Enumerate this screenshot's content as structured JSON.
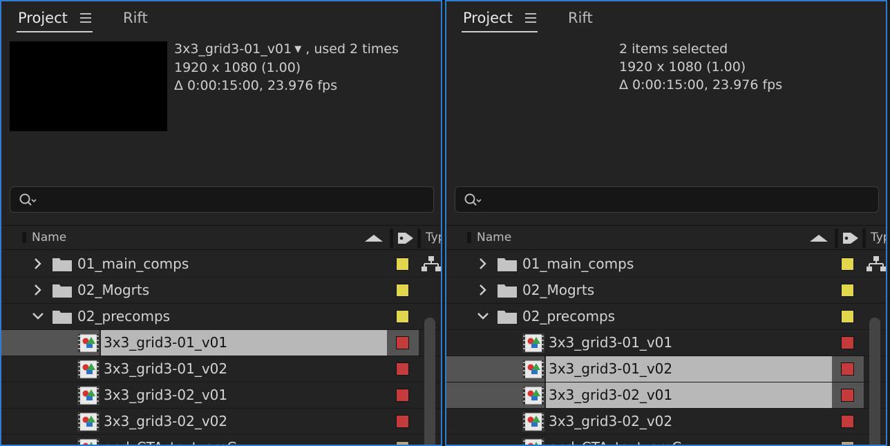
{
  "tabs": {
    "project": "Project",
    "rift": "Rift"
  },
  "search": {
    "placeholder": ""
  },
  "columns": {
    "name": "Name",
    "type": "Typ"
  },
  "colors": {
    "yellow": "#e2d64c",
    "red": "#c33b3b",
    "tan": "#b7a386",
    "accent_border": "#2d7fd6"
  },
  "left_panel": {
    "info": {
      "title": "3x3_grid3-01_v01",
      "used": ", used 2 times",
      "resolution": "1920 x 1080 (1.00)",
      "duration": "Δ 0:00:15:00, 23.976 fps"
    },
    "rows": [
      {
        "name": "01_main_comps",
        "kind": "folder",
        "expanded": false,
        "label": "yellow",
        "selected": false,
        "type_icon": "network-icon"
      },
      {
        "name": "02_Mogrts",
        "kind": "folder",
        "expanded": false,
        "label": "yellow",
        "selected": false
      },
      {
        "name": "02_precomps",
        "kind": "folder",
        "expanded": true,
        "label": "yellow",
        "selected": false
      },
      {
        "name": "3x3_grid3-01_v01",
        "kind": "comp",
        "label": "red",
        "selected": true
      },
      {
        "name": "3x3_grid3-01_v02",
        "kind": "comp",
        "label": "red",
        "selected": false
      },
      {
        "name": "3x3_grid3-02_v01",
        "kind": "comp",
        "label": "red",
        "selected": false
      },
      {
        "name": "3x3_grid3-02_v02",
        "kind": "comp",
        "label": "red",
        "selected": false
      },
      {
        "name": "end_CTA_text_preC",
        "kind": "comp",
        "label": "tan",
        "selected": false
      }
    ]
  },
  "right_panel": {
    "info": {
      "title": "2 items selected",
      "resolution": "1920 x 1080 (1.00)",
      "duration": "Δ 0:00:15:00, 23.976 fps"
    },
    "rows": [
      {
        "name": "01_main_comps",
        "kind": "folder",
        "expanded": false,
        "label": "yellow",
        "selected": false,
        "type_icon": "network-icon"
      },
      {
        "name": "02_Mogrts",
        "kind": "folder",
        "expanded": false,
        "label": "yellow",
        "selected": false
      },
      {
        "name": "02_precomps",
        "kind": "folder",
        "expanded": true,
        "label": "yellow",
        "selected": false
      },
      {
        "name": "3x3_grid3-01_v01",
        "kind": "comp",
        "label": "red",
        "selected": false
      },
      {
        "name": "3x3_grid3-01_v02",
        "kind": "comp",
        "label": "red",
        "selected": true
      },
      {
        "name": "3x3_grid3-02_v01",
        "kind": "comp",
        "label": "red",
        "selected": true
      },
      {
        "name": "3x3_grid3-02_v02",
        "kind": "comp",
        "label": "red",
        "selected": false
      },
      {
        "name": "end_CTA_text_preC",
        "kind": "comp",
        "label": "tan",
        "selected": false
      }
    ]
  }
}
